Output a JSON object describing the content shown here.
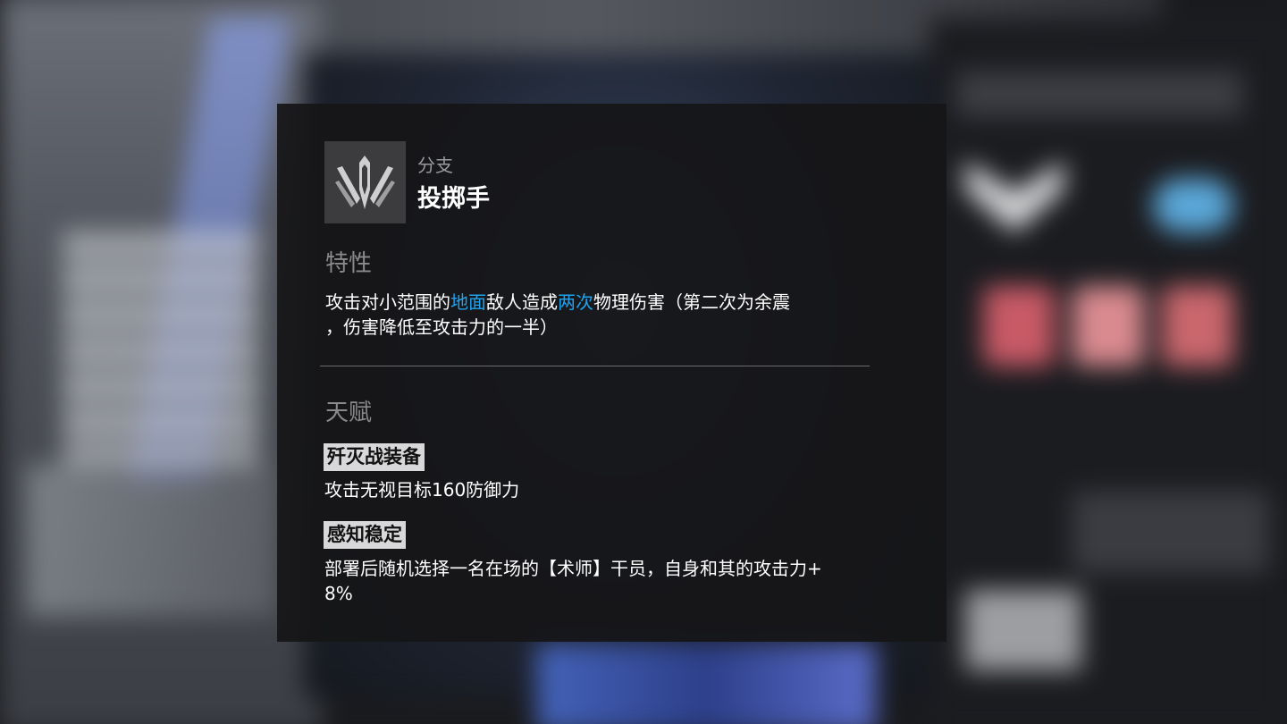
{
  "branch": {
    "tag_label": "分支",
    "name": "投掷手",
    "icon": "thrower-branch-icon"
  },
  "trait": {
    "section_title": "特性",
    "parts": [
      {
        "text": "攻击对小范围的",
        "highlight": false
      },
      {
        "text": "地面",
        "highlight": true
      },
      {
        "text": "敌人造成",
        "highlight": false
      },
      {
        "text": "两次",
        "highlight": true
      },
      {
        "text": "物理伤害（第二次为余震",
        "highlight": false
      },
      {
        "text": "，伤害降低至攻击力的一半）",
        "highlight": false
      }
    ]
  },
  "talent": {
    "section_title": "天赋",
    "items": [
      {
        "name": "歼灭战装备",
        "description": "攻击无视目标160防御力"
      },
      {
        "name": "感知稳定",
        "description_line1": "部署后随机选择一名在场的【术师】干员，自身和其的攻击力+",
        "description_line2": "8%"
      }
    ]
  },
  "colors": {
    "highlight": "#1ea3f0",
    "panel_bg": "#161618",
    "section_title": "#8a8a8c",
    "tag_bg": "#d8d8da"
  }
}
